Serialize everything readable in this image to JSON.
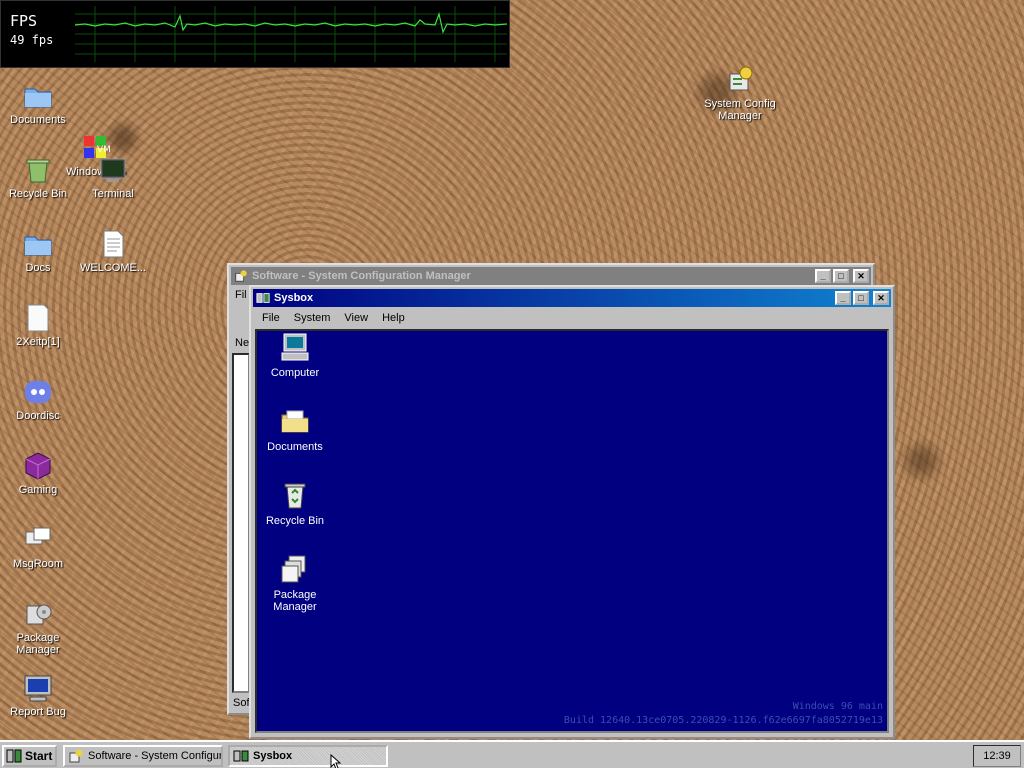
{
  "fps_monitor": {
    "label": "FPS",
    "value": "49 fps"
  },
  "desktop": {
    "icons": [
      {
        "label": "Documents",
        "icon": "folder-icon"
      },
      {
        "label": "Recycle Bin",
        "icon": "recycle-bin-icon"
      },
      {
        "label": "Windows 95",
        "icon": "vm-icon"
      },
      {
        "label": "Terminal",
        "icon": "terminal-icon"
      },
      {
        "label": "Docs",
        "icon": "folder-icon"
      },
      {
        "label": "WELCOME...",
        "icon": "text-file-icon"
      },
      {
        "label": "2Xeitp[1]",
        "icon": "blank-file-icon"
      },
      {
        "label": "Doordisc",
        "icon": "discord-icon"
      },
      {
        "label": "Gaming",
        "icon": "cube-icon"
      },
      {
        "label": "MsgRoom",
        "icon": "chat-icon"
      },
      {
        "label": "Package Manager",
        "icon": "package-icon"
      },
      {
        "label": "Report Bug",
        "icon": "monitor-icon"
      },
      {
        "label": "System Config Manager",
        "icon": "config-icon"
      }
    ]
  },
  "background_window": {
    "title": "Software - System Configuration Manager",
    "menu_fragment": "Fil",
    "side_fragment": "Ne",
    "status_fragment": "Sof"
  },
  "sysbox": {
    "title": "Sysbox",
    "menu": [
      "File",
      "System",
      "View",
      "Help"
    ],
    "icons": [
      {
        "label": "Computer",
        "icon": "computer-icon"
      },
      {
        "label": "Documents",
        "icon": "folder-icon"
      },
      {
        "label": "Recycle Bin",
        "icon": "recycle-bin-icon"
      },
      {
        "label": "Package Manager",
        "icon": "package-icon"
      }
    ],
    "build_line1": "Windows 96 main",
    "build_line2": "Build 12640.13ce0705.220829-1126.f62e6697fa8052719e13"
  },
  "taskbar": {
    "start_label": "Start",
    "tasks": [
      {
        "label": "Software - System Configur...",
        "active": false
      },
      {
        "label": "Sysbox",
        "active": true
      }
    ],
    "clock": "12:39"
  }
}
